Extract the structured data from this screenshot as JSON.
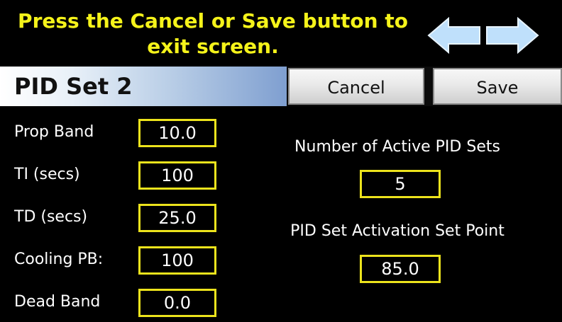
{
  "header": {
    "message_line1": "Press the Cancel or Save button to",
    "message_line2": "exit screen."
  },
  "title_bar": {
    "title": "PID Set 2",
    "cancel_label": "Cancel",
    "save_label": "Save"
  },
  "fields": [
    {
      "label": "Prop Band",
      "value": "10.0"
    },
    {
      "label": "TI  (secs)",
      "value": "100"
    },
    {
      "label": "TD  (secs)",
      "value": "25.0"
    },
    {
      "label": "Cooling PB:",
      "value": "100"
    },
    {
      "label": "Dead Band",
      "value": "0.0"
    }
  ],
  "active_sets": {
    "label": "Number of Active PID Sets",
    "value": "5"
  },
  "activation_point": {
    "label": "PID Set Activation Set Point",
    "value": "85.0"
  },
  "colors": {
    "accent_yellow": "#f5f31a",
    "box_border": "#ece31c",
    "arrow_fill": "#bfe0fb"
  },
  "icons": {
    "left": "arrow-left-icon",
    "right": "arrow-right-icon"
  }
}
